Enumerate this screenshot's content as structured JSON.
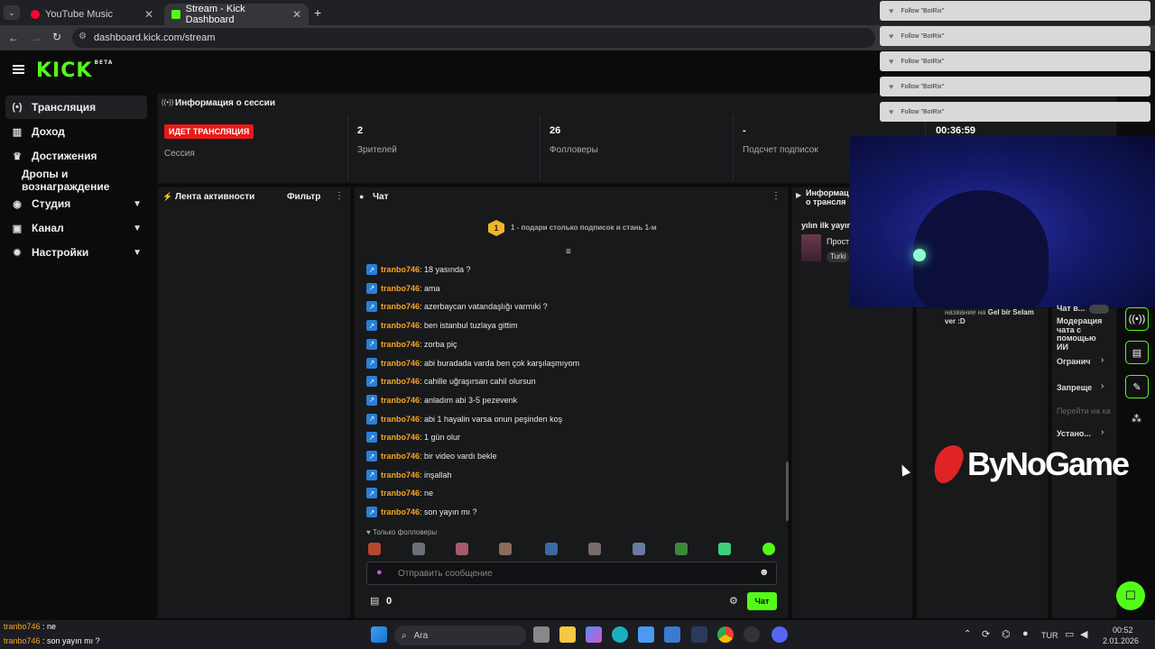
{
  "browser": {
    "tabs": [
      {
        "label": "YouTube Music"
      },
      {
        "label": "Stream - Kick Dashboard"
      }
    ],
    "url": "dashboard.kick.com/stream",
    "new_tab": "+"
  },
  "kick": {
    "logo": "KICK",
    "beta": "BETA"
  },
  "sidebar": {
    "items": [
      {
        "label": "Трансляция",
        "icon": "broadcast-icon"
      },
      {
        "label": "Доход",
        "icon": "income-icon"
      },
      {
        "label": "Достижения",
        "icon": "trophy-icon"
      },
      {
        "label": "Дропы и вознаграждение"
      },
      {
        "label": "Студия",
        "icon": "studio-icon"
      },
      {
        "label": "Канал",
        "icon": "channel-icon"
      },
      {
        "label": "Настройки",
        "icon": "settings-icon"
      }
    ]
  },
  "session": {
    "title": "Информация о сессии",
    "live_badge": "ИДЕТ ТРАНСЛЯЦИЯ",
    "session_label": "Сессия",
    "viewers_value": "2",
    "viewers_label": "Зрителей",
    "followers_value": "26",
    "followers_label": "Фолловеры",
    "subs_value": "-",
    "subs_label": "Подсчет подписок",
    "timer": "00:36:59"
  },
  "activity": {
    "title": "Лента активности",
    "filter": "Фильтр"
  },
  "chat": {
    "title": "Чат",
    "goal_text": "1 - подари столько подписок и стань 1-м",
    "goal_number": "1",
    "messages": [
      {
        "user": "tranbo746",
        "text": ": 18 yasında ?"
      },
      {
        "user": "tranbo746",
        "text": ": ama"
      },
      {
        "user": "tranbo746",
        "text": ": azerbaycan vatandaşlığı varmıki ?"
      },
      {
        "user": "tranbo746",
        "text": ": ben istanbul tuzlaya gittim"
      },
      {
        "user": "tranbo746",
        "text": ": zorba piç"
      },
      {
        "user": "tranbo746",
        "text": ": abi buradada varda ben çok karşılaşmıyom"
      },
      {
        "user": "tranbo746",
        "text": ": cahille uğraşırsan cahil olursun"
      },
      {
        "user": "tranbo746",
        "text": ": anladım abi 3-5 pezevenk"
      },
      {
        "user": "tranbo746",
        "text": ": abi 1 hayalin varsa onun peşinden koş"
      },
      {
        "user": "tranbo746",
        "text": ": 1 gün olur"
      },
      {
        "user": "tranbo746",
        "text": ": bir video vardı bekle"
      },
      {
        "user": "tranbo746",
        "text": ": inşallah"
      },
      {
        "user": "tranbo746",
        "text": ": ne"
      },
      {
        "user": "tranbo746",
        "text": ": son yayın mı ?"
      }
    ],
    "followers_only": "Только фолловеры",
    "input_placeholder": "Отправить сообщение",
    "points": "0",
    "send_label": "Чат"
  },
  "stream_info": {
    "title": "Информация о трансляции",
    "title_short": "Информац",
    "title_short2": "о трансля",
    "stream_title": "yılın ilk yayın",
    "category": "Прост",
    "tag": "Turki",
    "change_text": "название на",
    "change_bold": "Gel bir Selam ver :D"
  },
  "mod": {
    "chat_label": "Чат в...",
    "ai_mod": "Модерация чата с помощью ИИ",
    "limits": "Огранич",
    "banned": "Запреще",
    "goto": "Перейти на ка",
    "install": "Устано..."
  },
  "notifications": [
    {
      "text": "Follow \"BotRix\""
    },
    {
      "text": "Follow \"BotRix\""
    },
    {
      "text": "Follow \"BotRix\""
    },
    {
      "text": "Follow \"BotRix\""
    },
    {
      "text": "Follow \"BotRix\""
    }
  ],
  "watermark": "ByNoGame",
  "overlay_chat": [
    {
      "user": "tranbo746",
      "text": " : ne"
    },
    {
      "user": "tranbo746",
      "text": " : son yayın mı ?"
    }
  ],
  "taskbar": {
    "search": "Ara",
    "lang": "TUR",
    "time": "00:52",
    "date": "2.01.2026"
  },
  "colors": {
    "kick_green": "#53fc18",
    "live_red": "#e91916",
    "username": "#f5a623"
  }
}
